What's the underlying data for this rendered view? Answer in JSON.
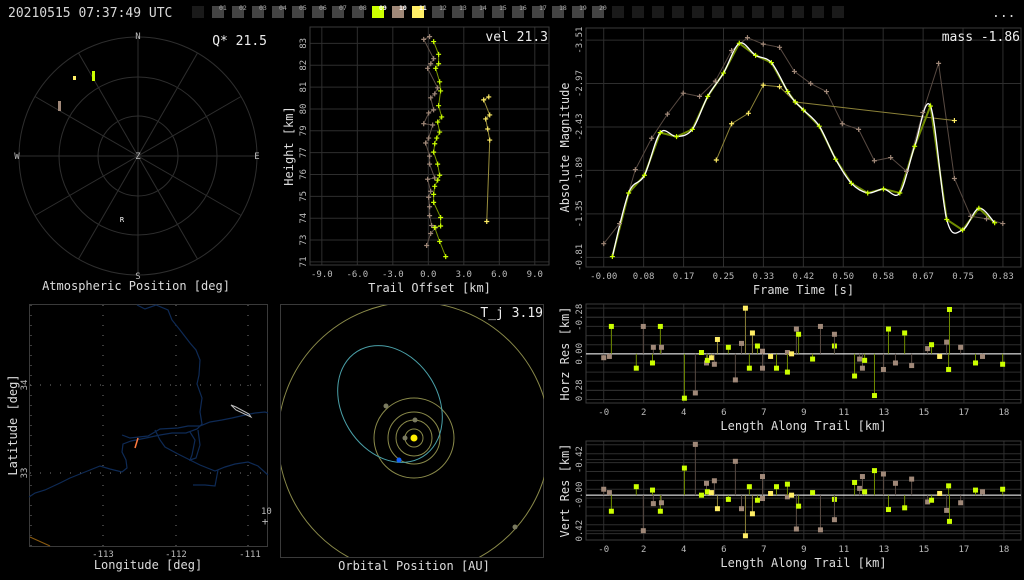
{
  "header": {
    "datetime": "20210515 07:37:49 UTC",
    "more_label": "...",
    "stations": [
      {
        "label": "",
        "color": "#1a1a1a"
      },
      {
        "label": "01",
        "color": "#444444"
      },
      {
        "label": "02",
        "color": "#444444"
      },
      {
        "label": "03",
        "color": "#444444"
      },
      {
        "label": "04",
        "color": "#444444"
      },
      {
        "label": "05",
        "color": "#444444"
      },
      {
        "label": "06",
        "color": "#444444"
      },
      {
        "label": "07",
        "color": "#444444"
      },
      {
        "label": "08",
        "color": "#444444"
      },
      {
        "label": "09",
        "color": "#ccff00"
      },
      {
        "label": "10",
        "color": "#a08878"
      },
      {
        "label": "11",
        "color": "#ffee66"
      },
      {
        "label": "12",
        "color": "#444444"
      },
      {
        "label": "13",
        "color": "#444444"
      },
      {
        "label": "14",
        "color": "#444444"
      },
      {
        "label": "15",
        "color": "#444444"
      },
      {
        "label": "16",
        "color": "#444444"
      },
      {
        "label": "17",
        "color": "#444444"
      },
      {
        "label": "18",
        "color": "#444444"
      },
      {
        "label": "19",
        "color": "#444444"
      },
      {
        "label": "20",
        "color": "#444444"
      },
      {
        "label": "",
        "color": "#1a1a1a"
      },
      {
        "label": "",
        "color": "#1a1a1a"
      },
      {
        "label": "",
        "color": "#1a1a1a"
      },
      {
        "label": "",
        "color": "#1a1a1a"
      },
      {
        "label": "",
        "color": "#1a1a1a"
      },
      {
        "label": "",
        "color": "#1a1a1a"
      },
      {
        "label": "",
        "color": "#1a1a1a"
      },
      {
        "label": "",
        "color": "#1a1a1a"
      },
      {
        "label": "",
        "color": "#1a1a1a"
      },
      {
        "label": "",
        "color": "#1a1a1a"
      },
      {
        "label": "",
        "color": "#1a1a1a"
      },
      {
        "label": "",
        "color": "#1a1a1a"
      }
    ]
  },
  "colors": {
    "lime": "#ccff00",
    "brown": "#a08878",
    "yellow": "#ffee66",
    "river": "#0e2a55",
    "orbit": "#8a8a4a",
    "meteoroid_orbit": "#4aa0a8",
    "sun": "#ffee00",
    "meteoroid": "#1060ff"
  },
  "atmos": {
    "title": "Atmospheric Position [deg]",
    "corner": "Q* 21.5",
    "n": "N",
    "s": "S",
    "e": "E",
    "w": "W",
    "z": "Z",
    "r": "R"
  },
  "map": {
    "xlabel": "Longitude [deg]",
    "ylabel": "Latitude [deg]",
    "xticks": [
      "-113",
      "-112",
      "-111"
    ],
    "yticks": [
      "34",
      "33"
    ],
    "scale_label": "10"
  },
  "orbit": {
    "title": "Orbital Position [AU]",
    "corner": "T_j 3.19"
  },
  "chart_data": [
    {
      "type": "line",
      "id": "height",
      "corner": "vel 21.3",
      "xlabel": "Trail Offset [km]",
      "ylabel": "Height [km]",
      "xlim": [
        -10.0,
        10.2
      ],
      "ylim": [
        71.23,
        84.3
      ],
      "xticks": [
        -9,
        -6,
        -3,
        0,
        3,
        6,
        9
      ],
      "xtick_labels": [
        "-9.0",
        "-6.0",
        "-3.0",
        "0.0",
        "3.0",
        "6.0",
        "9.0"
      ],
      "yticks": [
        71.4,
        72.6,
        73.8,
        75.0,
        76.2,
        77.4,
        78.6,
        79.8,
        81.0,
        82.2,
        83.4
      ],
      "ytick_labels": [
        "71",
        "73",
        "74",
        "75",
        "76",
        "77",
        "79",
        "80",
        "81",
        "82",
        "83"
      ],
      "series": [
        {
          "name": "10",
          "color": "brown",
          "points": [
            [
              0.11,
              83.77
            ],
            [
              -0.39,
              83.62
            ],
            [
              0.45,
              82.56
            ],
            [
              0.2,
              82.28
            ],
            [
              -0.06,
              82.03
            ],
            [
              0.79,
              80.96
            ],
            [
              0.54,
              80.63
            ],
            [
              0.2,
              80.41
            ],
            [
              0.45,
              79.75
            ],
            [
              0.03,
              79.58
            ],
            [
              -0.39,
              78.99
            ],
            [
              0.37,
              78.92
            ],
            [
              0.03,
              78.2
            ],
            [
              -0.23,
              77.93
            ],
            [
              0.11,
              77.21
            ],
            [
              0.11,
              76.77
            ],
            [
              0.54,
              76.01
            ],
            [
              -0.06,
              75.94
            ],
            [
              0.2,
              75.28
            ],
            [
              0.03,
              74.95
            ],
            [
              0.11,
              74.43
            ],
            [
              0.11,
              73.94
            ],
            [
              0.28,
              73.4
            ],
            [
              0.62,
              73.28
            ],
            [
              0.2,
              72.96
            ],
            [
              -0.14,
              72.3
            ]
          ]
        },
        {
          "name": "09",
          "color": "lime",
          "points": [
            [
              0.45,
              83.5
            ],
            [
              0.87,
              82.8
            ],
            [
              0.87,
              82.28
            ],
            [
              0.62,
              82.03
            ],
            [
              0.96,
              81.29
            ],
            [
              1.04,
              80.79
            ],
            [
              0.87,
              79.98
            ],
            [
              1.13,
              79.36
            ],
            [
              0.79,
              79.08
            ],
            [
              0.96,
              78.53
            ],
            [
              0.71,
              78.2
            ],
            [
              0.54,
              77.89
            ],
            [
              0.45,
              77.43
            ],
            [
              0.79,
              76.77
            ],
            [
              0.96,
              76.16
            ],
            [
              0.79,
              75.89
            ],
            [
              0.54,
              75.55
            ],
            [
              0.45,
              75.11
            ],
            [
              0.45,
              74.67
            ],
            [
              1.04,
              73.84
            ],
            [
              1.04,
              73.37
            ],
            [
              0.54,
              73.29
            ],
            [
              0.96,
              72.52
            ],
            [
              1.47,
              71.69
            ]
          ]
        },
        {
          "name": "11",
          "color": "yellow",
          "points": [
            [
              5.11,
              80.46
            ],
            [
              4.68,
              80.3
            ],
            [
              5.19,
              79.47
            ],
            [
              4.85,
              79.25
            ],
            [
              5.02,
              78.7
            ],
            [
              5.19,
              78.09
            ],
            [
              4.94,
              73.62
            ]
          ]
        }
      ]
    },
    {
      "type": "line",
      "id": "mag",
      "corner": "mass -1.86",
      "xlabel": "Frame Time [s]",
      "ylabel": "Absolute Magnitude",
      "xlim": [
        -0.037,
        0.871
      ],
      "ylim": [
        -3.66,
        -0.69
      ],
      "xticks": [
        0,
        0.0833,
        0.1667,
        0.25,
        0.3333,
        0.4167,
        0.5,
        0.5833,
        0.6667,
        0.75,
        0.8333
      ],
      "xtick_labels": [
        "-0.00",
        "0.08",
        "0.17",
        "0.25",
        "0.33",
        "0.42",
        "0.50",
        "0.58",
        "0.67",
        "0.75",
        "0.83"
      ],
      "yticks": [
        -3.51,
        -2.97,
        -2.43,
        -1.89,
        -1.35,
        -0.81
      ],
      "ytick_labels": [
        "-3.51",
        "-2.97",
        "-2.43",
        "-1.89",
        "-1.35",
        "-0.81"
      ],
      "series": [
        {
          "name": "10",
          "color": "brown",
          "points": [
            [
              0.0,
              -0.98
            ],
            [
              0.033,
              -1.23
            ],
            [
              0.066,
              -1.9
            ],
            [
              0.1,
              -2.29
            ],
            [
              0.133,
              -2.59
            ],
            [
              0.166,
              -2.85
            ],
            [
              0.2,
              -2.81
            ],
            [
              0.233,
              -3.0
            ],
            [
              0.267,
              -3.38
            ],
            [
              0.3,
              -3.54
            ],
            [
              0.333,
              -3.46
            ],
            [
              0.367,
              -3.42
            ],
            [
              0.398,
              -3.12
            ],
            [
              0.432,
              -2.97
            ],
            [
              0.465,
              -2.87
            ],
            [
              0.498,
              -2.47
            ],
            [
              0.532,
              -2.4
            ],
            [
              0.565,
              -2.01
            ],
            [
              0.599,
              -2.05
            ],
            [
              0.632,
              -1.88
            ],
            [
              0.666,
              -2.61
            ],
            [
              0.699,
              -3.22
            ],
            [
              0.732,
              -1.79
            ],
            [
              0.766,
              -1.32
            ],
            [
              0.799,
              -1.29
            ],
            [
              0.833,
              -1.23
            ]
          ]
        },
        {
          "name": "11",
          "color": "yellow",
          "points": [
            [
              0.235,
              -2.02
            ],
            [
              0.267,
              -2.47
            ],
            [
              0.302,
              -2.6
            ],
            [
              0.333,
              -2.95
            ],
            [
              0.367,
              -2.93
            ],
            [
              0.4,
              -2.74
            ],
            [
              0.732,
              -2.51
            ]
          ]
        },
        {
          "name": "09",
          "color": "lime",
          "points": [
            [
              0.018,
              -0.82
            ],
            [
              0.052,
              -1.61
            ],
            [
              0.085,
              -1.83
            ],
            [
              0.118,
              -2.36
            ],
            [
              0.152,
              -2.31
            ],
            [
              0.185,
              -2.4
            ],
            [
              0.217,
              -2.81
            ],
            [
              0.25,
              -3.1
            ],
            [
              0.283,
              -3.47
            ],
            [
              0.317,
              -3.32
            ],
            [
              0.35,
              -3.23
            ],
            [
              0.384,
              -2.87
            ],
            [
              0.4,
              -2.74
            ],
            [
              0.417,
              -2.64
            ],
            [
              0.45,
              -2.44
            ],
            [
              0.484,
              -2.03
            ],
            [
              0.517,
              -1.73
            ],
            [
              0.551,
              -1.61
            ],
            [
              0.584,
              -1.66
            ],
            [
              0.618,
              -1.61
            ],
            [
              0.649,
              -2.19
            ],
            [
              0.682,
              -2.69
            ],
            [
              0.716,
              -1.28
            ],
            [
              0.749,
              -1.15
            ],
            [
              0.783,
              -1.42
            ],
            [
              0.816,
              -1.24
            ]
          ]
        }
      ],
      "fit": {
        "name": "fit",
        "color": "#ffffff"
      }
    },
    {
      "type": "scatter",
      "id": "resid",
      "xlabel": "Length Along Trail [km]",
      "xlim": [
        -0.81,
        19.08
      ],
      "xticks": [
        0,
        1.83,
        3.66,
        5.49,
        7.32,
        9.15,
        10.98,
        12.81,
        14.64,
        16.47,
        18.3
      ],
      "xtick_labels": [
        "-0",
        "2",
        "4",
        "6",
        "7",
        "9",
        "11",
        "13",
        "15",
        "17",
        "18"
      ],
      "horz": {
        "ylabel": "Horz Res [km]",
        "ylim": [
          -0.382,
          0.377
        ],
        "yticks": [
          0.28,
          0,
          -0.28
        ],
        "ytick_labels": [
          "0.28",
          "0.00",
          "-0.28"
        ]
      },
      "vert": {
        "ylabel": "Vert Res [km]",
        "ylim": [
          -0.64,
          0.53
        ],
        "yticks": [
          0.42,
          0,
          -0.42
        ],
        "ytick_labels": [
          "0.42",
          "-0.00",
          "-0.42"
        ]
      },
      "columns": [
        "length_km",
        "horz_res_km",
        "vert_res_km",
        "station_color"
      ],
      "points": [
        [
          0.0,
          0.03,
          -0.07,
          "brown"
        ],
        [
          0.26,
          0.02,
          -0.03,
          "brown"
        ],
        [
          0.35,
          -0.21,
          0.19,
          "lime"
        ],
        [
          1.49,
          0.11,
          -0.1,
          "lime"
        ],
        [
          1.81,
          -0.21,
          0.42,
          "brown"
        ],
        [
          2.23,
          0.07,
          -0.06,
          "lime"
        ],
        [
          2.27,
          -0.05,
          0.1,
          "brown"
        ],
        [
          2.59,
          -0.21,
          0.19,
          "lime"
        ],
        [
          2.64,
          -0.05,
          0.09,
          "brown"
        ],
        [
          3.69,
          0.34,
          -0.32,
          "lime"
        ],
        [
          4.19,
          0.3,
          -0.6,
          "brown"
        ],
        [
          4.47,
          -0.01,
          0.0,
          "lime"
        ],
        [
          4.7,
          0.07,
          -0.14,
          "brown"
        ],
        [
          4.74,
          0.05,
          -0.04,
          "lime"
        ],
        [
          4.93,
          0.03,
          -0.03,
          "yellow"
        ],
        [
          5.06,
          0.08,
          -0.17,
          "brown"
        ],
        [
          5.2,
          -0.11,
          0.16,
          "yellow"
        ],
        [
          5.7,
          -0.05,
          0.05,
          "lime"
        ],
        [
          6.02,
          0.2,
          -0.4,
          "brown"
        ],
        [
          6.3,
          -0.08,
          0.16,
          "brown"
        ],
        [
          6.48,
          -0.35,
          0.48,
          "yellow"
        ],
        [
          6.66,
          0.11,
          -0.1,
          "lime"
        ],
        [
          6.8,
          -0.16,
          0.22,
          "yellow"
        ],
        [
          7.03,
          -0.06,
          0.06,
          "lime"
        ],
        [
          7.26,
          0.11,
          0.04,
          "brown"
        ],
        [
          7.26,
          -0.02,
          -0.22,
          "brown"
        ],
        [
          7.63,
          0.02,
          -0.02,
          "yellow"
        ],
        [
          7.9,
          0.11,
          -0.1,
          "lime"
        ],
        [
          8.4,
          -0.01,
          0.02,
          "brown"
        ],
        [
          8.4,
          0.14,
          -0.13,
          "lime"
        ],
        [
          8.59,
          0.0,
          0.0,
          "yellow"
        ],
        [
          8.81,
          -0.19,
          0.4,
          "brown"
        ],
        [
          8.91,
          -0.15,
          0.13,
          "lime"
        ],
        [
          9.55,
          0.04,
          -0.03,
          "lime"
        ],
        [
          9.91,
          -0.21,
          0.41,
          "brown"
        ],
        [
          10.55,
          -0.06,
          0.05,
          "lime"
        ],
        [
          10.55,
          -0.15,
          0.29,
          "brown"
        ],
        [
          11.47,
          0.17,
          -0.15,
          "lime"
        ],
        [
          11.7,
          0.04,
          -0.08,
          "brown"
        ],
        [
          11.83,
          0.11,
          -0.22,
          "brown"
        ],
        [
          11.93,
          0.05,
          -0.04,
          "lime"
        ],
        [
          12.38,
          0.32,
          -0.29,
          "lime"
        ],
        [
          12.79,
          0.12,
          -0.25,
          "brown"
        ],
        [
          13.02,
          -0.19,
          0.17,
          "lime"
        ],
        [
          13.34,
          0.07,
          -0.14,
          "brown"
        ],
        [
          13.76,
          -0.16,
          0.15,
          "lime"
        ],
        [
          14.08,
          0.09,
          -0.19,
          "brown"
        ],
        [
          14.81,
          -0.04,
          0.08,
          "brown"
        ],
        [
          14.99,
          -0.07,
          0.06,
          "lime"
        ],
        [
          15.36,
          0.02,
          -0.02,
          "yellow"
        ],
        [
          15.68,
          -0.09,
          0.18,
          "brown"
        ],
        [
          15.77,
          0.12,
          -0.11,
          "lime"
        ],
        [
          15.81,
          -0.34,
          0.31,
          "lime"
        ],
        [
          16.32,
          -0.05,
          0.09,
          "brown"
        ],
        [
          17.0,
          0.07,
          -0.06,
          "lime"
        ],
        [
          17.32,
          0.02,
          -0.04,
          "brown"
        ],
        [
          18.24,
          0.08,
          -0.07,
          "lime"
        ]
      ]
    }
  ]
}
